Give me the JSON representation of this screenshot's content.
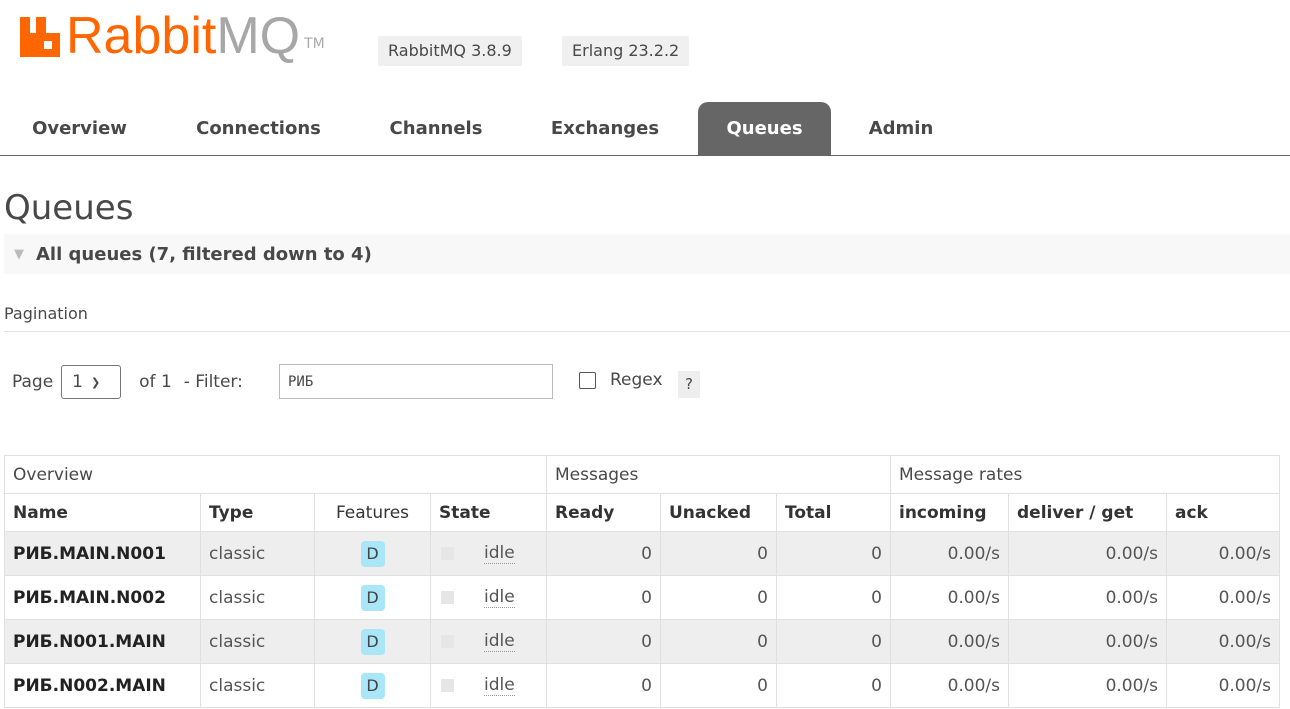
{
  "header": {
    "logo_main": "Rabbit",
    "logo_mq": "MQ",
    "logo_tm": "TM",
    "rabbitmq_version": "RabbitMQ 3.8.9",
    "erlang_version": "Erlang 23.2.2",
    "brand_color": "#ff6600"
  },
  "nav": {
    "tabs": [
      {
        "label": "Overview"
      },
      {
        "label": "Connections"
      },
      {
        "label": "Channels"
      },
      {
        "label": "Exchanges"
      },
      {
        "label": "Queues",
        "active": true
      },
      {
        "label": "Admin"
      }
    ]
  },
  "page": {
    "title": "Queues",
    "section": "All queues (7, filtered down to 4)"
  },
  "pagination": {
    "label": "Pagination",
    "page_label": "Page",
    "page_value": "1",
    "of_label": "of 1",
    "filter_label": "- Filter:",
    "filter_value": "РИБ",
    "regex_label": "Regex",
    "help_label": "?"
  },
  "table": {
    "groups": [
      "Overview",
      "Messages",
      "Message rates"
    ],
    "columns": [
      "Name",
      "Type",
      "Features",
      "State",
      "Ready",
      "Unacked",
      "Total",
      "incoming",
      "deliver / get",
      "ack"
    ],
    "rows": [
      {
        "name": "РИБ.MAIN.N001",
        "type": "classic",
        "feature": "D",
        "state": "idle",
        "ready": "0",
        "unacked": "0",
        "total": "0",
        "incoming": "0.00/s",
        "deliver": "0.00/s",
        "ack": "0.00/s"
      },
      {
        "name": "РИБ.MAIN.N002",
        "type": "classic",
        "feature": "D",
        "state": "idle",
        "ready": "0",
        "unacked": "0",
        "total": "0",
        "incoming": "0.00/s",
        "deliver": "0.00/s",
        "ack": "0.00/s"
      },
      {
        "name": "РИБ.N001.MAIN",
        "type": "classic",
        "feature": "D",
        "state": "idle",
        "ready": "0",
        "unacked": "0",
        "total": "0",
        "incoming": "0.00/s",
        "deliver": "0.00/s",
        "ack": "0.00/s"
      },
      {
        "name": "РИБ.N002.MAIN",
        "type": "classic",
        "feature": "D",
        "state": "idle",
        "ready": "0",
        "unacked": "0",
        "total": "0",
        "incoming": "0.00/s",
        "deliver": "0.00/s",
        "ack": "0.00/s"
      }
    ]
  }
}
